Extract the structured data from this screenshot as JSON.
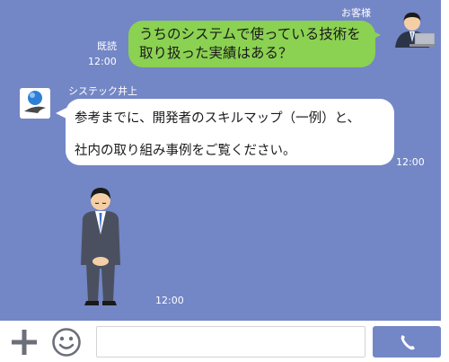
{
  "chat": {
    "customer_name": "お客様",
    "read_label": "既読",
    "outgoing": {
      "line1": "うちのシステムで使っている技術を",
      "line2": "取り扱った実績はある？",
      "time": "12:00"
    },
    "bot_name": "システック井上",
    "incoming": {
      "line1": "参考までに、開発者のスキルマップ（一例）と、",
      "line2": "社内の取り組み事例をご覧ください。",
      "time": "12:00"
    },
    "sticker_time": "12:00"
  },
  "input_bar": {
    "plus_icon": "plus-icon",
    "emoji_icon": "smiley-icon",
    "message_placeholder": "",
    "call_icon": "phone-icon"
  },
  "colors": {
    "background": "#7386c6",
    "outgoing_bubble": "#8bd152",
    "incoming_bubble": "#ffffff",
    "call_button": "#7386c6"
  }
}
